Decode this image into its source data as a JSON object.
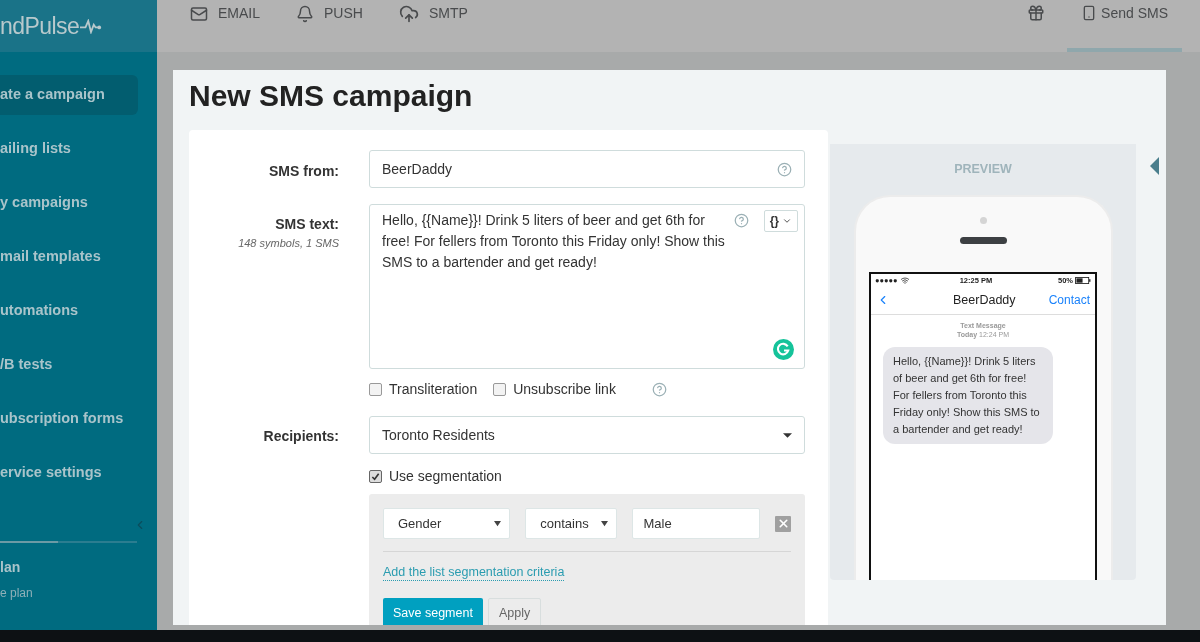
{
  "logo": {
    "text": "ndPulse"
  },
  "top_nav": [
    {
      "label": "EMAIL",
      "kind": "email"
    },
    {
      "label": "PUSH",
      "kind": "push"
    },
    {
      "label": "SMTP",
      "kind": "smtp"
    }
  ],
  "top_right": {
    "send_sms": {
      "label": "Send SMS",
      "selected": true
    }
  },
  "sidebar": {
    "items": [
      {
        "label": "ate a campaign",
        "selected": true
      },
      {
        "label": "ailing lists",
        "selected": false
      },
      {
        "label": "y campaigns",
        "selected": false
      },
      {
        "label": "mail templates",
        "selected": false
      },
      {
        "label": "utomations",
        "selected": false
      },
      {
        "label": "/B tests",
        "selected": false
      },
      {
        "label": "ubscription forms",
        "selected": false
      },
      {
        "label": "ervice settings",
        "selected": false
      }
    ],
    "plan": {
      "title": "lan",
      "subtitle": "e plan"
    }
  },
  "modal": {
    "title": "New SMS campaign",
    "form": {
      "sms_from": {
        "label": "SMS from:",
        "value": "BeerDaddy"
      },
      "sms_text": {
        "label": "SMS text:",
        "hint": "148 symbols, 1 SMS",
        "value": "Hello, {{Name}}! Drink 5 liters of beer and get 6th for free! For fellers from Toronto this Friday only! Show this SMS to a bartender and get ready!",
        "variables_button": "{}"
      },
      "options": [
        {
          "label": "Transliteration",
          "checked": false
        },
        {
          "label": "Unsubscribe link",
          "checked": false
        }
      ],
      "recipients": {
        "label": "Recipients:",
        "value": "Toronto Residents"
      },
      "use_segmentation": {
        "label": "Use segmentation",
        "checked": true
      },
      "segment": {
        "field": "Gender",
        "operator": "contains",
        "value": "Male",
        "add_link": "Add the list segmentation criteria",
        "save_button": "Save segment",
        "apply_button": "Apply"
      }
    },
    "preview": {
      "title": "PREVIEW",
      "phone": {
        "carrier": "●●●●●",
        "time": "12:25 PM",
        "battery": "50%",
        "contact_name": "BeerDaddy",
        "contact_link": "Contact",
        "meta_title": "Text Message",
        "meta_day": "Today",
        "meta_time": "12:24 PM",
        "message": "Hello, {{Name}}! Drink 5 liters of beer and get 6th for free! For fellers from Toronto this Friday only! Show this SMS to a bartender and get ready!"
      }
    }
  }
}
